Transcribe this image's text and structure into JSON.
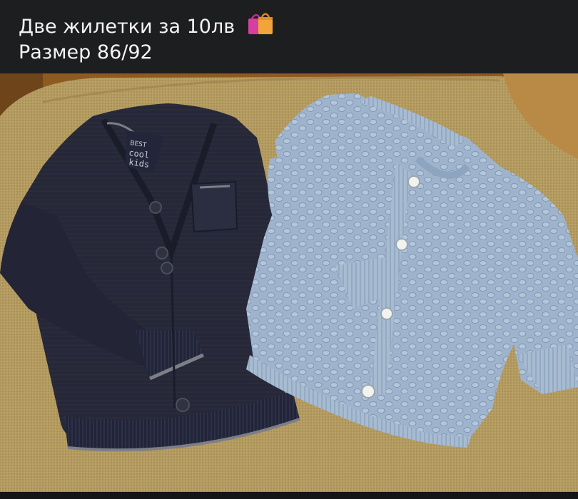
{
  "caption": {
    "line1": "Две жилетки за 10лв",
    "line2": "Размер 86/92",
    "line1_emoji": "shopping-bags-icon"
  },
  "photo": {
    "left_item_tag": "BEST COOL KIDS",
    "colors": {
      "sofa": "#b39a5f",
      "navy_cardigan": "#262838",
      "blue_cardigan": "#9fb4cc",
      "tipping": "#7d7f87",
      "background_wall": "#8e5a1f",
      "cushion": "#b98a45"
    }
  }
}
